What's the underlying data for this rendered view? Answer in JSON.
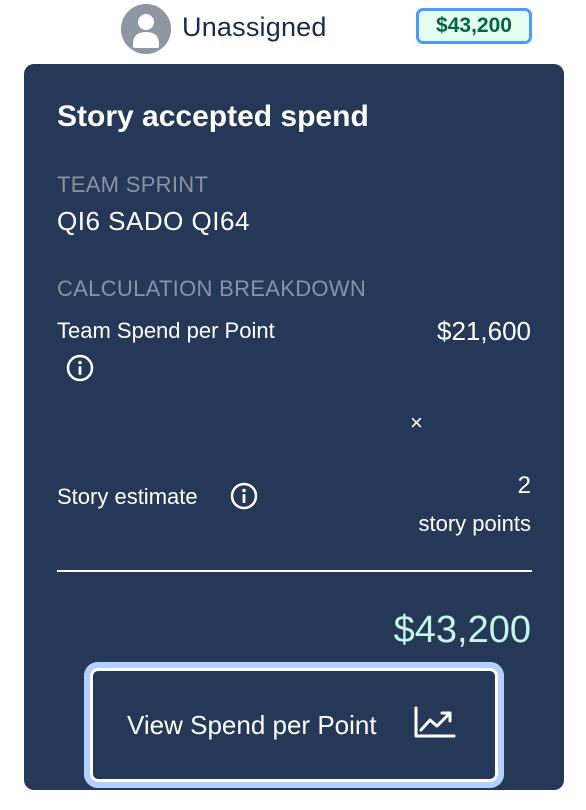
{
  "header": {
    "assignee": "Unassigned",
    "amount": "$43,200",
    "avatar_icon": "user-avatar-icon"
  },
  "card": {
    "title": "Story accepted spend",
    "team_sprint": {
      "heading": "TEAM SPRINT",
      "value": "QI6 SADO QI64"
    },
    "breakdown": {
      "heading": "CALCULATION BREAKDOWN",
      "spend_per_point_label": "Team Spend per Point",
      "spend_per_point_value": "$21,600",
      "operator": "×",
      "story_estimate_label": "Story estimate",
      "story_estimate_value": "2",
      "story_estimate_unit": "story points"
    },
    "total": "$43,200",
    "button": {
      "label": "View Spend per Point",
      "icon": "trending-chart-icon"
    }
  },
  "colors": {
    "card_background": "#253858",
    "badge_border": "#4c9aff",
    "badge_text": "#006644",
    "total_text": "#c6f6e6",
    "muted_heading": "#8993a4",
    "focus_ring": "#b3d0ff"
  }
}
